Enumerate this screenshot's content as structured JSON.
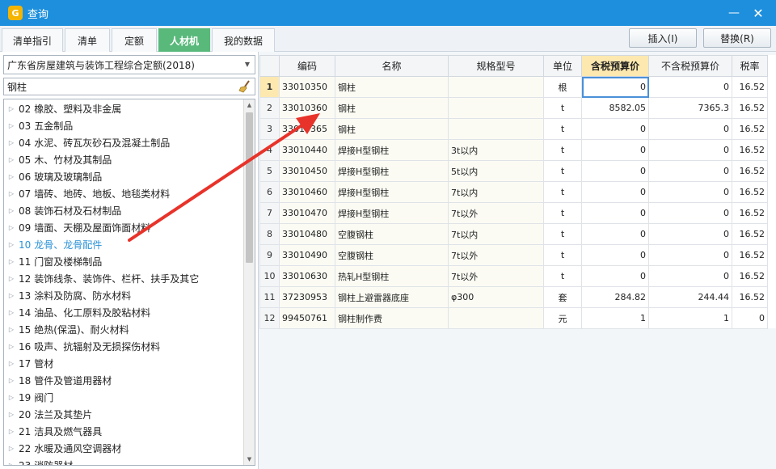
{
  "window": {
    "title": "查询",
    "min_label": "—",
    "close_label": "✕"
  },
  "tabs": [
    {
      "label": "清单指引"
    },
    {
      "label": "清单"
    },
    {
      "label": "定额"
    },
    {
      "label": "人材机"
    },
    {
      "label": "我的数据"
    }
  ],
  "toolbar": {
    "insert_label": "插入(I)",
    "replace_label": "替换(R)"
  },
  "left": {
    "quota_select": "广东省房屋建筑与装饰工程综合定额(2018)",
    "search_value": "钢柱",
    "tree": [
      {
        "code": "02",
        "name": "橡胶、塑料及非金属"
      },
      {
        "code": "03",
        "name": "五金制品"
      },
      {
        "code": "04",
        "name": "水泥、砖瓦灰砂石及混凝土制品"
      },
      {
        "code": "05",
        "name": "木、竹材及其制品"
      },
      {
        "code": "06",
        "name": "玻璃及玻璃制品"
      },
      {
        "code": "07",
        "name": "墙砖、地砖、地板、地毯类材料"
      },
      {
        "code": "08",
        "name": "装饰石材及石材制品"
      },
      {
        "code": "09",
        "name": "墙面、天棚及屋面饰面材料"
      },
      {
        "code": "10",
        "name": "龙骨、龙骨配件"
      },
      {
        "code": "11",
        "name": "门窗及楼梯制品"
      },
      {
        "code": "12",
        "name": "装饰线条、装饰件、栏杆、扶手及其它"
      },
      {
        "code": "13",
        "name": "涂料及防腐、防水材料"
      },
      {
        "code": "14",
        "name": "油品、化工原料及胶粘材料"
      },
      {
        "code": "15",
        "name": "绝热(保温)、耐火材料"
      },
      {
        "code": "16",
        "name": "吸声、抗辐射及无损探伤材料"
      },
      {
        "code": "17",
        "name": "管材"
      },
      {
        "code": "18",
        "name": "管件及管道用器材"
      },
      {
        "code": "19",
        "name": "阀门"
      },
      {
        "code": "20",
        "name": "法兰及其垫片"
      },
      {
        "code": "21",
        "name": "洁具及燃气器具"
      },
      {
        "code": "22",
        "name": "水暖及通风空调器材"
      },
      {
        "code": "23",
        "name": "消防器材"
      }
    ]
  },
  "table": {
    "headers": [
      "编码",
      "名称",
      "规格型号",
      "单位",
      "含税预算价",
      "不含税预算价",
      "税率"
    ],
    "rows": [
      {
        "n": "1",
        "code": "33010350",
        "name": "钢柱",
        "spec": "",
        "unit": "根",
        "tax_price": "0",
        "notax_price": "0",
        "rate": "16.52"
      },
      {
        "n": "2",
        "code": "33010360",
        "name": "钢柱",
        "spec": "",
        "unit": "t",
        "tax_price": "8582.05",
        "notax_price": "7365.3",
        "rate": "16.52"
      },
      {
        "n": "3",
        "code": "33010365",
        "name": "钢柱",
        "spec": "",
        "unit": "t",
        "tax_price": "0",
        "notax_price": "0",
        "rate": "16.52"
      },
      {
        "n": "4",
        "code": "33010440",
        "name": "焊接H型钢柱",
        "spec": "3t以内",
        "unit": "t",
        "tax_price": "0",
        "notax_price": "0",
        "rate": "16.52"
      },
      {
        "n": "5",
        "code": "33010450",
        "name": "焊接H型钢柱",
        "spec": "5t以内",
        "unit": "t",
        "tax_price": "0",
        "notax_price": "0",
        "rate": "16.52"
      },
      {
        "n": "6",
        "code": "33010460",
        "name": "焊接H型钢柱",
        "spec": "7t以内",
        "unit": "t",
        "tax_price": "0",
        "notax_price": "0",
        "rate": "16.52"
      },
      {
        "n": "7",
        "code": "33010470",
        "name": "焊接H型钢柱",
        "spec": "7t以外",
        "unit": "t",
        "tax_price": "0",
        "notax_price": "0",
        "rate": "16.52"
      },
      {
        "n": "8",
        "code": "33010480",
        "name": "空腹钢柱",
        "spec": "7t以内",
        "unit": "t",
        "tax_price": "0",
        "notax_price": "0",
        "rate": "16.52"
      },
      {
        "n": "9",
        "code": "33010490",
        "name": "空腹钢柱",
        "spec": "7t以外",
        "unit": "t",
        "tax_price": "0",
        "notax_price": "0",
        "rate": "16.52"
      },
      {
        "n": "10",
        "code": "33010630",
        "name": "热轧H型钢柱",
        "spec": "7t以外",
        "unit": "t",
        "tax_price": "0",
        "notax_price": "0",
        "rate": "16.52"
      },
      {
        "n": "11",
        "code": "37230953",
        "name": "钢柱上避雷器底座",
        "spec": "φ300",
        "unit": "套",
        "tax_price": "284.82",
        "notax_price": "244.44",
        "rate": "16.52"
      },
      {
        "n": "12",
        "code": "99450761",
        "name": "钢柱制作费",
        "spec": "",
        "unit": "元",
        "tax_price": "1",
        "notax_price": "1",
        "rate": "0"
      }
    ]
  },
  "colors": {
    "titlebar": "#1e8fdd",
    "active_tab": "#58b97b",
    "highlight_col": "#fde9b0",
    "tree_highlight": "#2a92d6",
    "annotation_arrow": "#e8332a"
  }
}
